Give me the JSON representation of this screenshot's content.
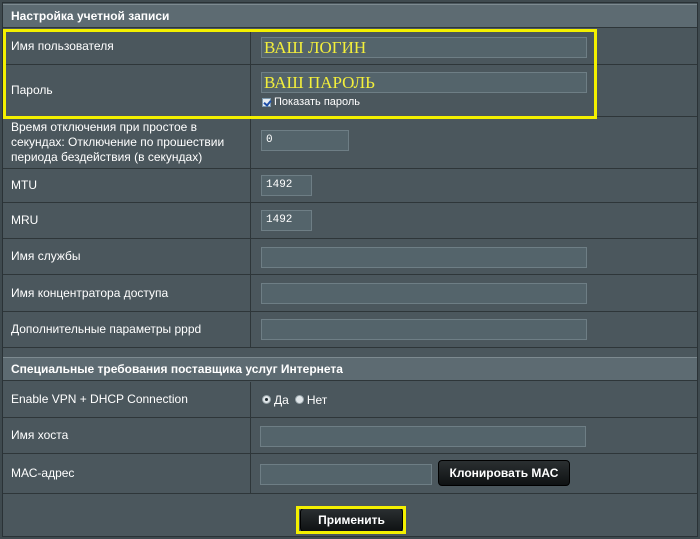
{
  "account_section": {
    "title": "Настройка учетной записи",
    "username_label": "Имя пользователя",
    "username_value": "ВАШ ЛОГИН",
    "password_label": "Пароль",
    "password_value": "ВАШ ПАРОЛЬ",
    "show_password_label": "Показать пароль",
    "idle_label": "Время отключения при простое в секундах: Отключение по прошествии периода бездействия (в секундах)",
    "idle_value": "0",
    "mtu_label": "MTU",
    "mtu_value": "1492",
    "mru_label": "MRU",
    "mru_value": "1492",
    "service_label": "Имя службы",
    "service_value": "",
    "concentrator_label": "Имя концентратора доступа",
    "concentrator_value": "",
    "pppd_label": "Дополнительные параметры pppd",
    "pppd_value": ""
  },
  "isp_section": {
    "title": "Специальные требования поставщика услуг Интернета",
    "vpn_label": "Enable VPN + DHCP Connection",
    "vpn_yes": "Да",
    "vpn_no": "Нет",
    "host_label": "Имя хоста",
    "host_value": "",
    "mac_label": "МАС-адрес",
    "mac_value": "",
    "clone_mac_button": "Клонировать МАС"
  },
  "apply_button": "Применить",
  "colors": {
    "highlight": "#f4f000",
    "panel": "#4b575d",
    "overlay_text": "#f3ef3b"
  },
  "icons": {
    "show_password": "checkbox-checked-icon",
    "vpn_yes": "radio-selected-icon",
    "vpn_no": "radio-unselected-icon"
  }
}
